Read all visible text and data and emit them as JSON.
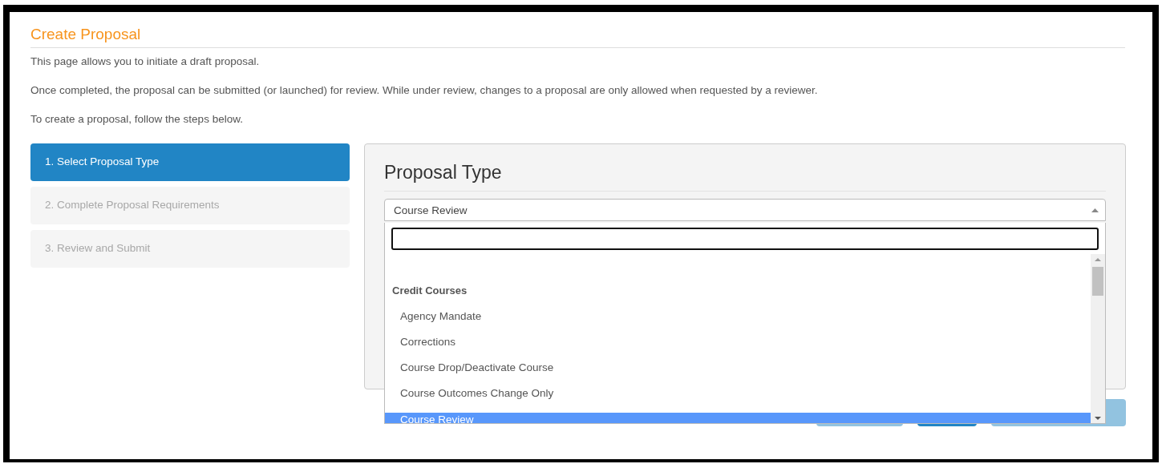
{
  "page": {
    "title": "Create Proposal",
    "intro": [
      "This page allows you to initiate a draft proposal.",
      "Once completed, the proposal can be submitted (or launched) for review. While under review, changes to a proposal are only allowed when requested by a reviewer.",
      "To create a proposal, follow the steps below."
    ]
  },
  "steps": [
    {
      "label": "1. Select Proposal Type",
      "selected": true,
      "disabled": false
    },
    {
      "label": "2. Complete Proposal Requirements",
      "selected": false,
      "disabled": true
    },
    {
      "label": "3. Review and Submit",
      "selected": false,
      "disabled": true
    }
  ],
  "panel": {
    "heading": "Proposal Type",
    "select": {
      "value": "Course Review",
      "expanded": true
    },
    "groups": [
      {
        "label": "Credit Courses",
        "options": [
          {
            "label": "Agency Mandate",
            "selected": false
          },
          {
            "label": "Corrections",
            "selected": false
          },
          {
            "label": "Course Drop/Deactivate Course",
            "selected": false
          },
          {
            "label": "Course Outcomes Change Only",
            "selected": false
          },
          {
            "label": "Course Review",
            "selected": true
          }
        ]
      }
    ]
  },
  "buttons": [
    {
      "kind": "secondary"
    },
    {
      "kind": "primary"
    },
    {
      "kind": "secondary"
    }
  ]
}
